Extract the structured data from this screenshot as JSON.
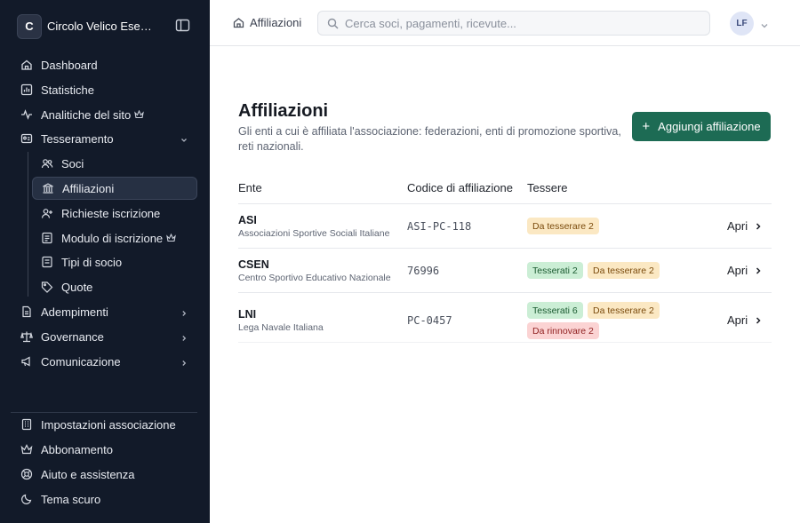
{
  "sidebar": {
    "brand_initial": "C",
    "brand_name": "Circolo Velico Esempio",
    "items": [
      {
        "label": "Dashboard",
        "icon": "home-icon"
      },
      {
        "label": "Statistiche",
        "icon": "chart-icon"
      },
      {
        "label": "Analitiche del sito",
        "icon": "pulse-icon",
        "premium": true
      },
      {
        "label": "Tesseramento",
        "icon": "id-card-icon",
        "expanded": true
      }
    ],
    "sub_items": [
      {
        "label": "Soci",
        "icon": "users-icon"
      },
      {
        "label": "Affiliazioni",
        "icon": "bank-icon",
        "active": true
      },
      {
        "label": "Richieste iscrizione",
        "icon": "user-plus-icon"
      },
      {
        "label": "Modulo di iscrizione",
        "icon": "form-icon",
        "premium": true
      },
      {
        "label": "Tipi di socio",
        "icon": "list-icon"
      },
      {
        "label": "Quote",
        "icon": "tag-icon"
      }
    ],
    "groups": [
      {
        "label": "Adempimenti",
        "icon": "document-icon"
      },
      {
        "label": "Governance",
        "icon": "scale-icon"
      },
      {
        "label": "Comunicazione",
        "icon": "megaphone-icon"
      }
    ],
    "footer": [
      {
        "label": "Impostazioni associazione",
        "icon": "building-icon"
      },
      {
        "label": "Abbonamento",
        "icon": "crown-icon"
      },
      {
        "label": "Aiuto e assistenza",
        "icon": "lifebuoy-icon"
      },
      {
        "label": "Tema scuro",
        "icon": "moon-icon"
      }
    ]
  },
  "topbar": {
    "breadcrumb": "Affiliazioni",
    "search_placeholder": "Cerca soci, pagamenti, ricevute...",
    "avatar_initials": "LF"
  },
  "main": {
    "title": "Affiliazioni",
    "subtitle": "Gli enti a cui è affiliata l'associazione: federazioni, enti di promozione sportiva, reti nazionali.",
    "add_button": "Aggiungi affiliazione",
    "columns": [
      "Ente",
      "Codice di affiliazione",
      "Tessere"
    ],
    "open_label": "Apri",
    "rows": [
      {
        "name": "ASI",
        "full": "Associazioni Sportive Sociali Italiane",
        "code": "ASI-PC-118",
        "badges": [
          {
            "text": "Da tesserare 2",
            "kind": "yellow"
          }
        ]
      },
      {
        "name": "CSEN",
        "full": "Centro Sportivo Educativo Nazionale",
        "code": "76996",
        "badges": [
          {
            "text": "Tesserati 2",
            "kind": "green"
          },
          {
            "text": "Da tesserare 2",
            "kind": "yellow"
          }
        ]
      },
      {
        "name": "LNI",
        "full": "Lega Navale Italiana",
        "code": "PC-0457",
        "badges": [
          {
            "text": "Tesserati 6",
            "kind": "green"
          },
          {
            "text": "Da tesserare 2",
            "kind": "yellow"
          },
          {
            "text": "Da rinnovare 2",
            "kind": "red"
          }
        ]
      }
    ]
  },
  "colors": {
    "sidebar_bg": "#121a29",
    "accent": "#1d6b54",
    "badge_yellow": "#fbe8c3",
    "badge_green": "#cbeed5",
    "badge_red": "#fbd3d3"
  }
}
